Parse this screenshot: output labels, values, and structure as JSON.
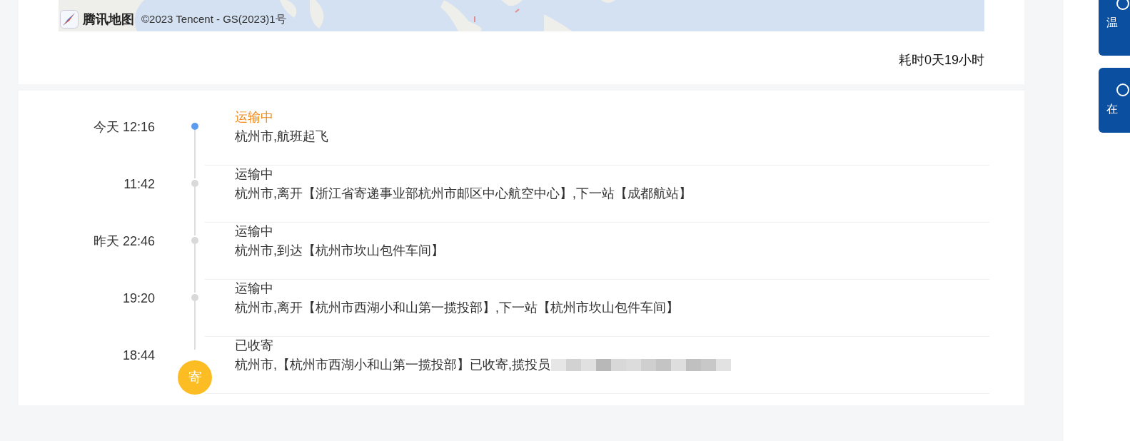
{
  "map": {
    "logo_text": "腾讯地图",
    "attribution": "©2023 Tencent - GS(2023)1号"
  },
  "duration": "耗时0天19小时",
  "events": [
    {
      "time": "今天 12:16",
      "status": "运输中",
      "detail": "杭州市,航班起飞",
      "kind": "latest"
    },
    {
      "time": "11:42",
      "status": "运输中",
      "detail": "杭州市,离开【浙江省寄递事业部杭州市邮区中心航空中心】,下一站【成都航站】",
      "kind": "normal"
    },
    {
      "time": "昨天 22:46",
      "status": "运输中",
      "detail": "杭州市,到达【杭州市坎山包件车间】",
      "kind": "normal"
    },
    {
      "time": "19:20",
      "status": "运输中",
      "detail": "杭州市,离开【杭州市西湖小和山第一揽投部】,下一站【杭州市坎山包件车间】",
      "kind": "normal"
    },
    {
      "time": "18:44",
      "status": "已收寄",
      "detail": "杭州市,【杭州市西湖小和山第一揽投部】已收寄,揽投员",
      "kind": "origin",
      "badge": "寄",
      "redacted": true
    }
  ],
  "side_buttons": [
    {
      "label": "温"
    },
    {
      "label": "在"
    }
  ]
}
